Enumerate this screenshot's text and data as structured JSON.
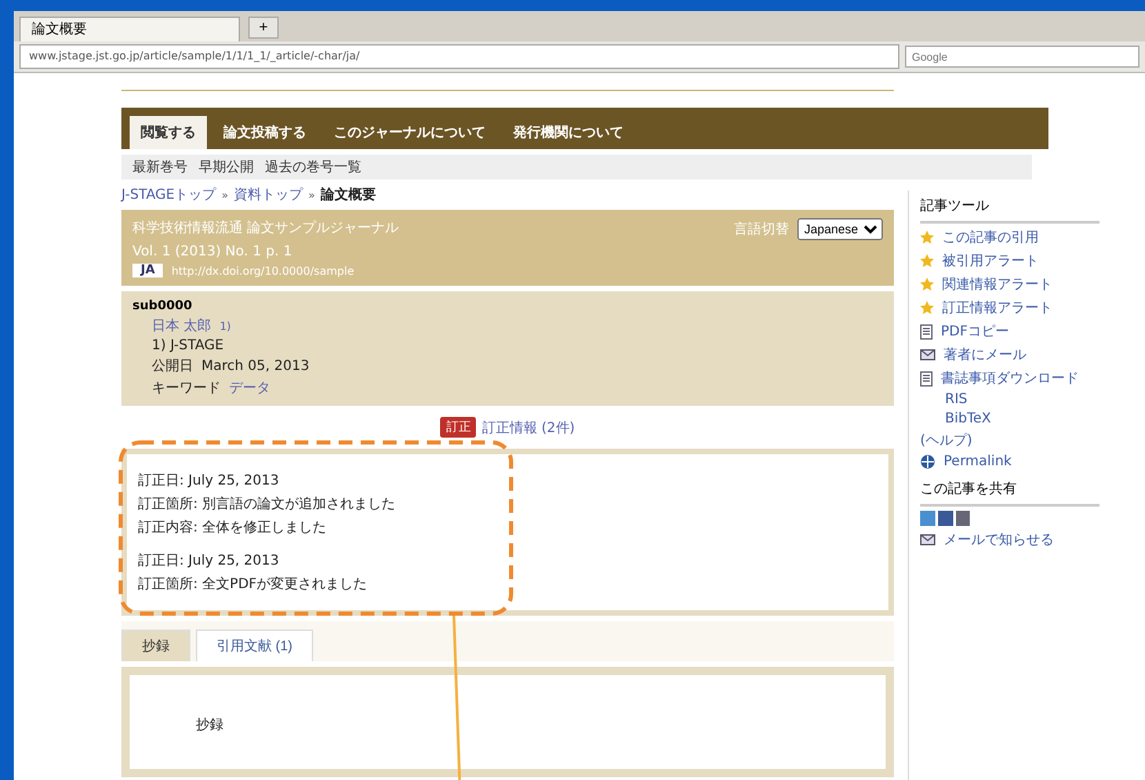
{
  "browser": {
    "tab_title": "論文概要",
    "new_tab": "+",
    "url": "www.jstage.jst.go.jp/article/sample/1/1/1_1/_article/-char/ja/",
    "search_placeholder": "Google"
  },
  "nav_tabs": [
    {
      "label": "閲覧する",
      "selected": true
    },
    {
      "label": "論文投稿する",
      "selected": false
    },
    {
      "label": "このジャーナルについて",
      "selected": false
    },
    {
      "label": "発行機関について",
      "selected": false
    }
  ],
  "sub_nav": [
    "最新巻号",
    "早期公開",
    "過去の巻号一覧"
  ],
  "breadcrumb": [
    "J-STAGEトップ",
    "資料トップ",
    "論文概要"
  ],
  "breadcrumb_separator": "»",
  "article_header": {
    "journal": "科学技術情報流通 論文サンプルジャーナル",
    "volume": "Vol. 1 (2013) No. 1 p. 1",
    "language_label": "言語切替",
    "language": "Japanese",
    "badge": "JA",
    "doi": "http://dx.doi.org/10.0000/sample"
  },
  "article": {
    "id": "sub0000",
    "author": "日本 太郎",
    "author_mark": "1)",
    "affiliation": "1) J-STAGE",
    "published_label": "公開日",
    "published": "March 05, 2013",
    "keywords_label": "キーワード",
    "keyword": "データ"
  },
  "errata_bar": {
    "badge": "訂正",
    "link": "訂正情報 (2件)"
  },
  "corrections": [
    {
      "lines": [
        "訂正日: July 25, 2013",
        "訂正箇所: 別言語の論文が追加されました",
        "訂正内容: 全体を修正しました"
      ]
    },
    {
      "lines": [
        "訂正日: July 25, 2013",
        "訂正箇所: 全文PDFが変更されました"
      ]
    }
  ],
  "content_tabs": [
    {
      "label": "抄録",
      "selected": true
    },
    {
      "label": "引用文献 (1)",
      "selected": false
    }
  ],
  "abstract_heading": "抄録",
  "sidebar": {
    "tools_title": "記事ツール",
    "tools": [
      {
        "kind": "star",
        "label": "この記事の引用"
      },
      {
        "kind": "star",
        "label": "被引用アラート"
      },
      {
        "kind": "star",
        "label": "関連情報アラート"
      },
      {
        "kind": "star",
        "label": "訂正情報アラート"
      },
      {
        "kind": "doc",
        "label": "PDFコピー"
      },
      {
        "kind": "mail",
        "label": "著者にメール"
      },
      {
        "kind": "doc",
        "label": "書誌事項ダウンロード"
      },
      {
        "kind": "plain",
        "label": "RIS"
      },
      {
        "kind": "plain",
        "label": "BibTeX"
      },
      {
        "kind": "more",
        "label": "(ヘルプ)"
      },
      {
        "kind": "globe",
        "label": "Permalink"
      }
    ],
    "share_title": "この記事を共有",
    "share_mail": "メールで知らせる"
  }
}
